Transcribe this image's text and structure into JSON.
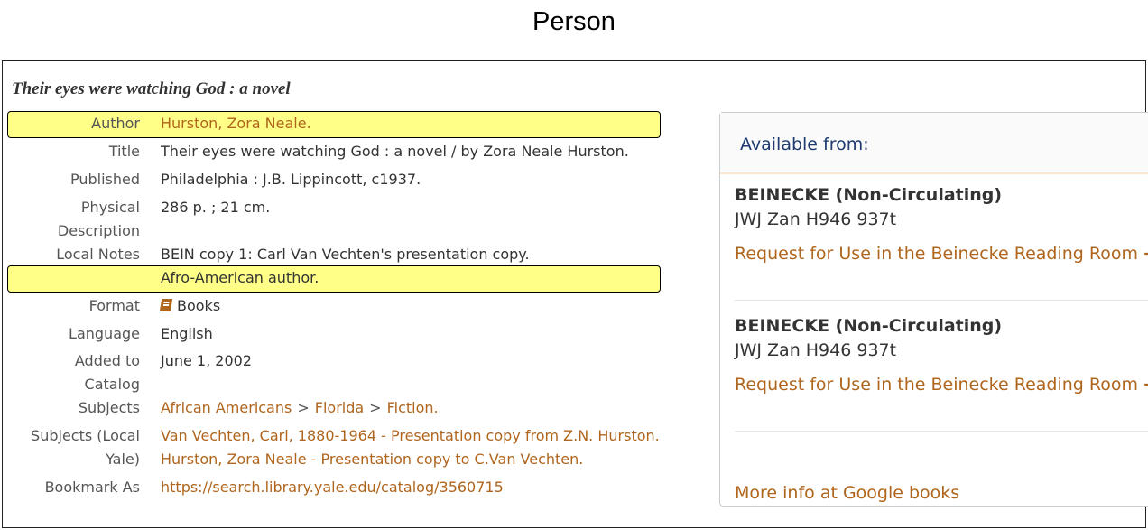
{
  "caption": "Person",
  "record": {
    "title": "Their eyes were watching God : a novel",
    "fields": {
      "author_label": "Author",
      "author_value": "Hurston, Zora Neale.",
      "title_label": "Title",
      "title_value": "Their eyes were watching God : a novel / by Zora Neale Hurston.",
      "published_label": "Published",
      "published_value": "Philadelphia : J.B. Lippincott, c1937.",
      "physical_label_1": "Physical",
      "physical_label_2": "Description",
      "physical_value": "286 p. ; 21 cm.",
      "local_notes_label": "Local Notes",
      "local_notes_value_1": "BEIN copy 1: Carl Van Vechten's presentation copy.",
      "local_notes_value_2": "Afro-American author.",
      "format_label": "Format",
      "format_value": "Books",
      "language_label": "Language",
      "language_value": "English",
      "added_label_1": "Added to",
      "added_label_2": "Catalog",
      "added_value": "June 1, 2002",
      "subjects_label": "Subjects",
      "subjects_parts": [
        "African Americans",
        "Florida",
        "Fiction."
      ],
      "subjects_separator": ">",
      "subjects_local_label_1": "Subjects (Local",
      "subjects_local_label_2": "Yale)",
      "subjects_local_1": "Van Vechten, Carl, 1880-1964 - Presentation copy from Z.N. Hurston.",
      "subjects_local_2": "Hurston, Zora Neale - Presentation copy to C.Van Vechten.",
      "bookmark_label": "Bookmark As",
      "bookmark_value": "https://search.library.yale.edu/catalog/3560715"
    }
  },
  "availability": {
    "heading": "Available from:",
    "holdings": [
      {
        "location": "BEINECKE (Non-Circulating)",
        "call_number": "JWJ Zan H946 937t",
        "request_label": "Request for Use in the Beinecke Reading Room",
        "arrow": "➔"
      },
      {
        "location": "BEINECKE (Non-Circulating)",
        "call_number": "JWJ Zan H946 937t",
        "request_label": "Request for Use in the Beinecke Reading Room",
        "arrow": "➔"
      }
    ],
    "google_books_label": "More info at Google books"
  },
  "colors": {
    "link": "#b0651d",
    "highlight": "#ffff88",
    "heading": "#1e3a6e"
  },
  "icons": {
    "format": "book-icon",
    "request": "arrow-right-icon"
  }
}
